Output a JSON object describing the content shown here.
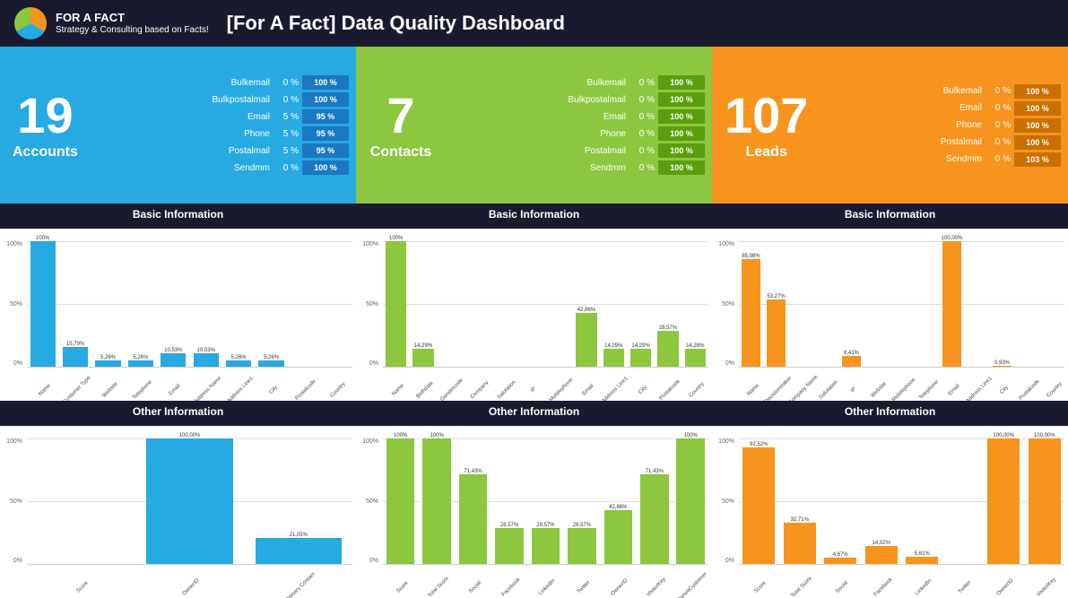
{
  "header": {
    "logo_alt": "For A Fact logo",
    "brand_name": "FOR A FACT",
    "brand_sub": "Strategy & Consulting based on Facts!",
    "title": "[For A Fact] Data Quality Dashboard"
  },
  "columns": [
    {
      "id": "accounts",
      "color": "blue",
      "count": "19",
      "label": "Accounts",
      "fields": [
        {
          "name": "Bulkemail",
          "pct": "0 %",
          "bar": "100 %"
        },
        {
          "name": "Bulkpostalmail",
          "pct": "0 %",
          "bar": "100 %"
        },
        {
          "name": "Email",
          "pct": "5 %",
          "bar": "95 %"
        },
        {
          "name": "Phone",
          "pct": "5 %",
          "bar": "95 %"
        },
        {
          "name": "Postalmail",
          "pct": "5 %",
          "bar": "95 %"
        },
        {
          "name": "Sendmm",
          "pct": "0 %",
          "bar": "100 %"
        }
      ],
      "basic_info_label": "Basic Information",
      "basic_bars": [
        {
          "label": "Name",
          "pct": "100%",
          "val": 100
        },
        {
          "label": "Customer Type",
          "pct": "15,79%",
          "val": 15.79
        },
        {
          "label": "Website",
          "pct": "5,26%",
          "val": 5.26
        },
        {
          "label": "Telephone",
          "pct": "5,26%",
          "val": 5.26
        },
        {
          "label": "Email",
          "pct": "10,53%",
          "val": 10.53
        },
        {
          "label": "Address Name",
          "pct": "10,53%",
          "val": 10.53
        },
        {
          "label": "Address Line1",
          "pct": "5,26%",
          "val": 5.26
        },
        {
          "label": "City",
          "pct": "5,26%",
          "val": 5.26
        },
        {
          "label": "Postalcode",
          "pct": "",
          "val": 0
        },
        {
          "label": "Country",
          "pct": "",
          "val": 0
        }
      ],
      "other_info_label": "Other Information",
      "other_bars": [
        {
          "label": "Score",
          "pct": "",
          "val": 0
        },
        {
          "label": "OwnerID",
          "pct": "100,00%",
          "val": 100
        },
        {
          "label": "Primary Contact",
          "pct": "21,05%",
          "val": 21.05
        }
      ]
    },
    {
      "id": "contacts",
      "color": "green",
      "count": "7",
      "label": "Contacts",
      "fields": [
        {
          "name": "Bulkemail",
          "pct": "0 %",
          "bar": "100 %"
        },
        {
          "name": "Bulkpostalmail",
          "pct": "0 %",
          "bar": "100 %"
        },
        {
          "name": "Email",
          "pct": "0 %",
          "bar": "100 %"
        },
        {
          "name": "Phone",
          "pct": "0 %",
          "bar": "100 %"
        },
        {
          "name": "Postalmail",
          "pct": "0 %",
          "bar": "100 %"
        },
        {
          "name": "Sendmm",
          "pct": "0 %",
          "bar": "100 %"
        }
      ],
      "basic_info_label": "Basic Information",
      "basic_bars": [
        {
          "label": "Name",
          "pct": "100%",
          "val": 100
        },
        {
          "label": "Birthdate",
          "pct": "14,29%",
          "val": 14.29
        },
        {
          "label": "Gendercode",
          "pct": "",
          "val": 0
        },
        {
          "label": "Company",
          "pct": "",
          "val": 0
        },
        {
          "label": "Salutation",
          "pct": "",
          "val": 0
        },
        {
          "label": "IP",
          "pct": "",
          "val": 0
        },
        {
          "label": "Mobilephone",
          "pct": "",
          "val": 0
        },
        {
          "label": "Email",
          "pct": "42,86%",
          "val": 42.86
        },
        {
          "label": "Address Line1",
          "pct": "14,29%",
          "val": 14.29
        },
        {
          "label": "City",
          "pct": "14,29%",
          "val": 14.29
        },
        {
          "label": "Postalcode",
          "pct": "28,57%",
          "val": 28.57
        },
        {
          "label": "Country",
          "pct": "14,28%",
          "val": 14.28
        }
      ],
      "other_info_label": "Other Information",
      "other_bars": [
        {
          "label": "Score",
          "pct": "100%",
          "val": 100
        },
        {
          "label": "Total Score",
          "pct": "100%",
          "val": 100
        },
        {
          "label": "Social",
          "pct": "71,43%",
          "val": 71.43
        },
        {
          "label": "Facebook",
          "pct": "28,57%",
          "val": 28.57
        },
        {
          "label": "LinkedIn",
          "pct": "28,57%",
          "val": 28.57
        },
        {
          "label": "Twitter",
          "pct": "28,57%",
          "val": 28.57
        },
        {
          "label": "OwnerID",
          "pct": "42,86%",
          "val": 42.86
        },
        {
          "label": "VisitorKey",
          "pct": "71,43%",
          "val": 71.43
        },
        {
          "label": "ParentCustomer",
          "pct": "100%",
          "val": 100
        }
      ]
    },
    {
      "id": "leads",
      "color": "orange",
      "count": "107",
      "label": "Leads",
      "fields": [
        {
          "name": "Bulkemail",
          "pct": "0 %",
          "bar": "100 %"
        },
        {
          "name": "Email",
          "pct": "0 %",
          "bar": "100 %"
        },
        {
          "name": "Phone",
          "pct": "0 %",
          "bar": "100 %"
        },
        {
          "name": "Postalmail",
          "pct": "0 %",
          "bar": "100 %"
        },
        {
          "name": "Sendmm",
          "pct": "0 %",
          "bar": "103 %"
        }
      ],
      "basic_info_label": "Basic Information",
      "basic_bars": [
        {
          "label": "Name",
          "pct": "85,98%",
          "val": 85.98
        },
        {
          "label": "Decisionmaker",
          "pct": "53,27%",
          "val": 53.27
        },
        {
          "label": "Company Name",
          "pct": "",
          "val": 0
        },
        {
          "label": "Salutation",
          "pct": "",
          "val": 0
        },
        {
          "label": "IP",
          "pct": "8,41%",
          "val": 8.41
        },
        {
          "label": "Website",
          "pct": "",
          "val": 0
        },
        {
          "label": "Mobilephone",
          "pct": "",
          "val": 0
        },
        {
          "label": "Telephone",
          "pct": "",
          "val": 0
        },
        {
          "label": "Email",
          "pct": "100,00%",
          "val": 100
        },
        {
          "label": "Address Line1",
          "pct": "",
          "val": 0
        },
        {
          "label": "City",
          "pct": "0,93%",
          "val": 0.93
        },
        {
          "label": "Postalcode",
          "pct": "",
          "val": 0
        },
        {
          "label": "Country",
          "pct": "",
          "val": 0
        }
      ],
      "other_info_label": "Other Information",
      "other_bars": [
        {
          "label": "Score",
          "pct": "92,52%",
          "val": 92.52
        },
        {
          "label": "Total Score",
          "pct": "32,71%",
          "val": 32.71
        },
        {
          "label": "Social",
          "pct": "4,67%",
          "val": 4.67
        },
        {
          "label": "Facebook",
          "pct": "14,02%",
          "val": 14.02
        },
        {
          "label": "LinkedIn",
          "pct": "5,61%",
          "val": 5.61
        },
        {
          "label": "Twitter",
          "pct": "",
          "val": 0
        },
        {
          "label": "OwnerID",
          "pct": "100,00%",
          "val": 100
        },
        {
          "label": "VisitorKey",
          "pct": "100,00%",
          "val": 100
        }
      ]
    }
  ]
}
